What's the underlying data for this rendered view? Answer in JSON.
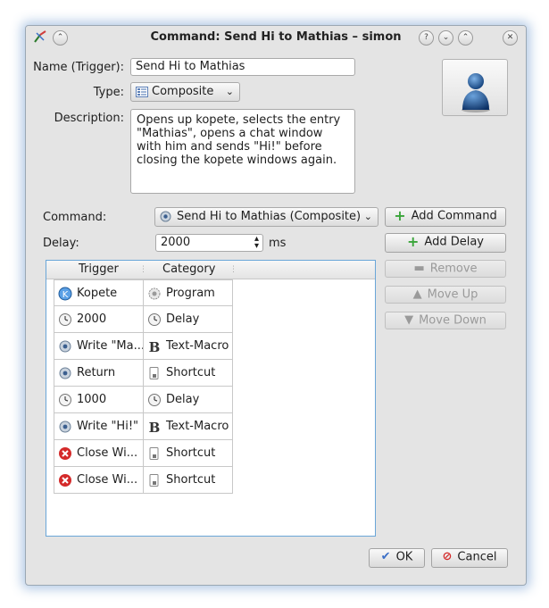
{
  "window": {
    "title": "Command: Send Hi to Mathias – simon"
  },
  "form": {
    "name_label": "Name (Trigger):",
    "name_value": "Send Hi to Mathias",
    "type_label": "Type:",
    "type_value": "Composite",
    "description_label": "Description:",
    "description_value": "Opens up kopete, selects the entry \"Mathias\", opens a chat window with him and sends \"Hi!\" before closing the kopete windows again.",
    "command_label": "Command:",
    "command_value": "Send Hi to Mathias (Composite)",
    "delay_label": "Delay:",
    "delay_value": "2000",
    "delay_unit": "ms"
  },
  "buttons": {
    "add_command": "Add Command",
    "add_delay": "Add Delay",
    "remove": "Remove",
    "move_up": "Move Up",
    "move_down": "Move Down",
    "ok": "OK",
    "cancel": "Cancel"
  },
  "table": {
    "columns": [
      "Trigger",
      "Category"
    ],
    "rows": [
      {
        "trigger": "Kopete",
        "category": "Program",
        "trigger_icon": "kopete-icon",
        "category_icon": "program-gear-icon"
      },
      {
        "trigger": "2000",
        "category": "Delay",
        "trigger_icon": "clock-icon",
        "category_icon": "clock-icon"
      },
      {
        "trigger": "Write \"Ma...",
        "category": "Text-Macro",
        "trigger_icon": "gear-icon",
        "category_icon": "text-macro-icon"
      },
      {
        "trigger": "Return",
        "category": "Shortcut",
        "trigger_icon": "gear-icon",
        "category_icon": "shortcut-key-icon"
      },
      {
        "trigger": "1000",
        "category": "Delay",
        "trigger_icon": "clock-icon",
        "category_icon": "clock-icon"
      },
      {
        "trigger": "Write \"Hi!\"",
        "category": "Text-Macro",
        "trigger_icon": "gear-icon",
        "category_icon": "text-macro-icon"
      },
      {
        "trigger": "Close Wi...",
        "category": "Shortcut",
        "trigger_icon": "close-red-icon",
        "category_icon": "shortcut-key-icon"
      },
      {
        "trigger": "Close Wi...",
        "category": "Shortcut",
        "trigger_icon": "close-red-icon",
        "category_icon": "shortcut-key-icon"
      }
    ]
  },
  "colors": {
    "accent_green": "#3aa53a",
    "selection_border": "#6aa6d8",
    "close_red": "#d42a2a"
  }
}
